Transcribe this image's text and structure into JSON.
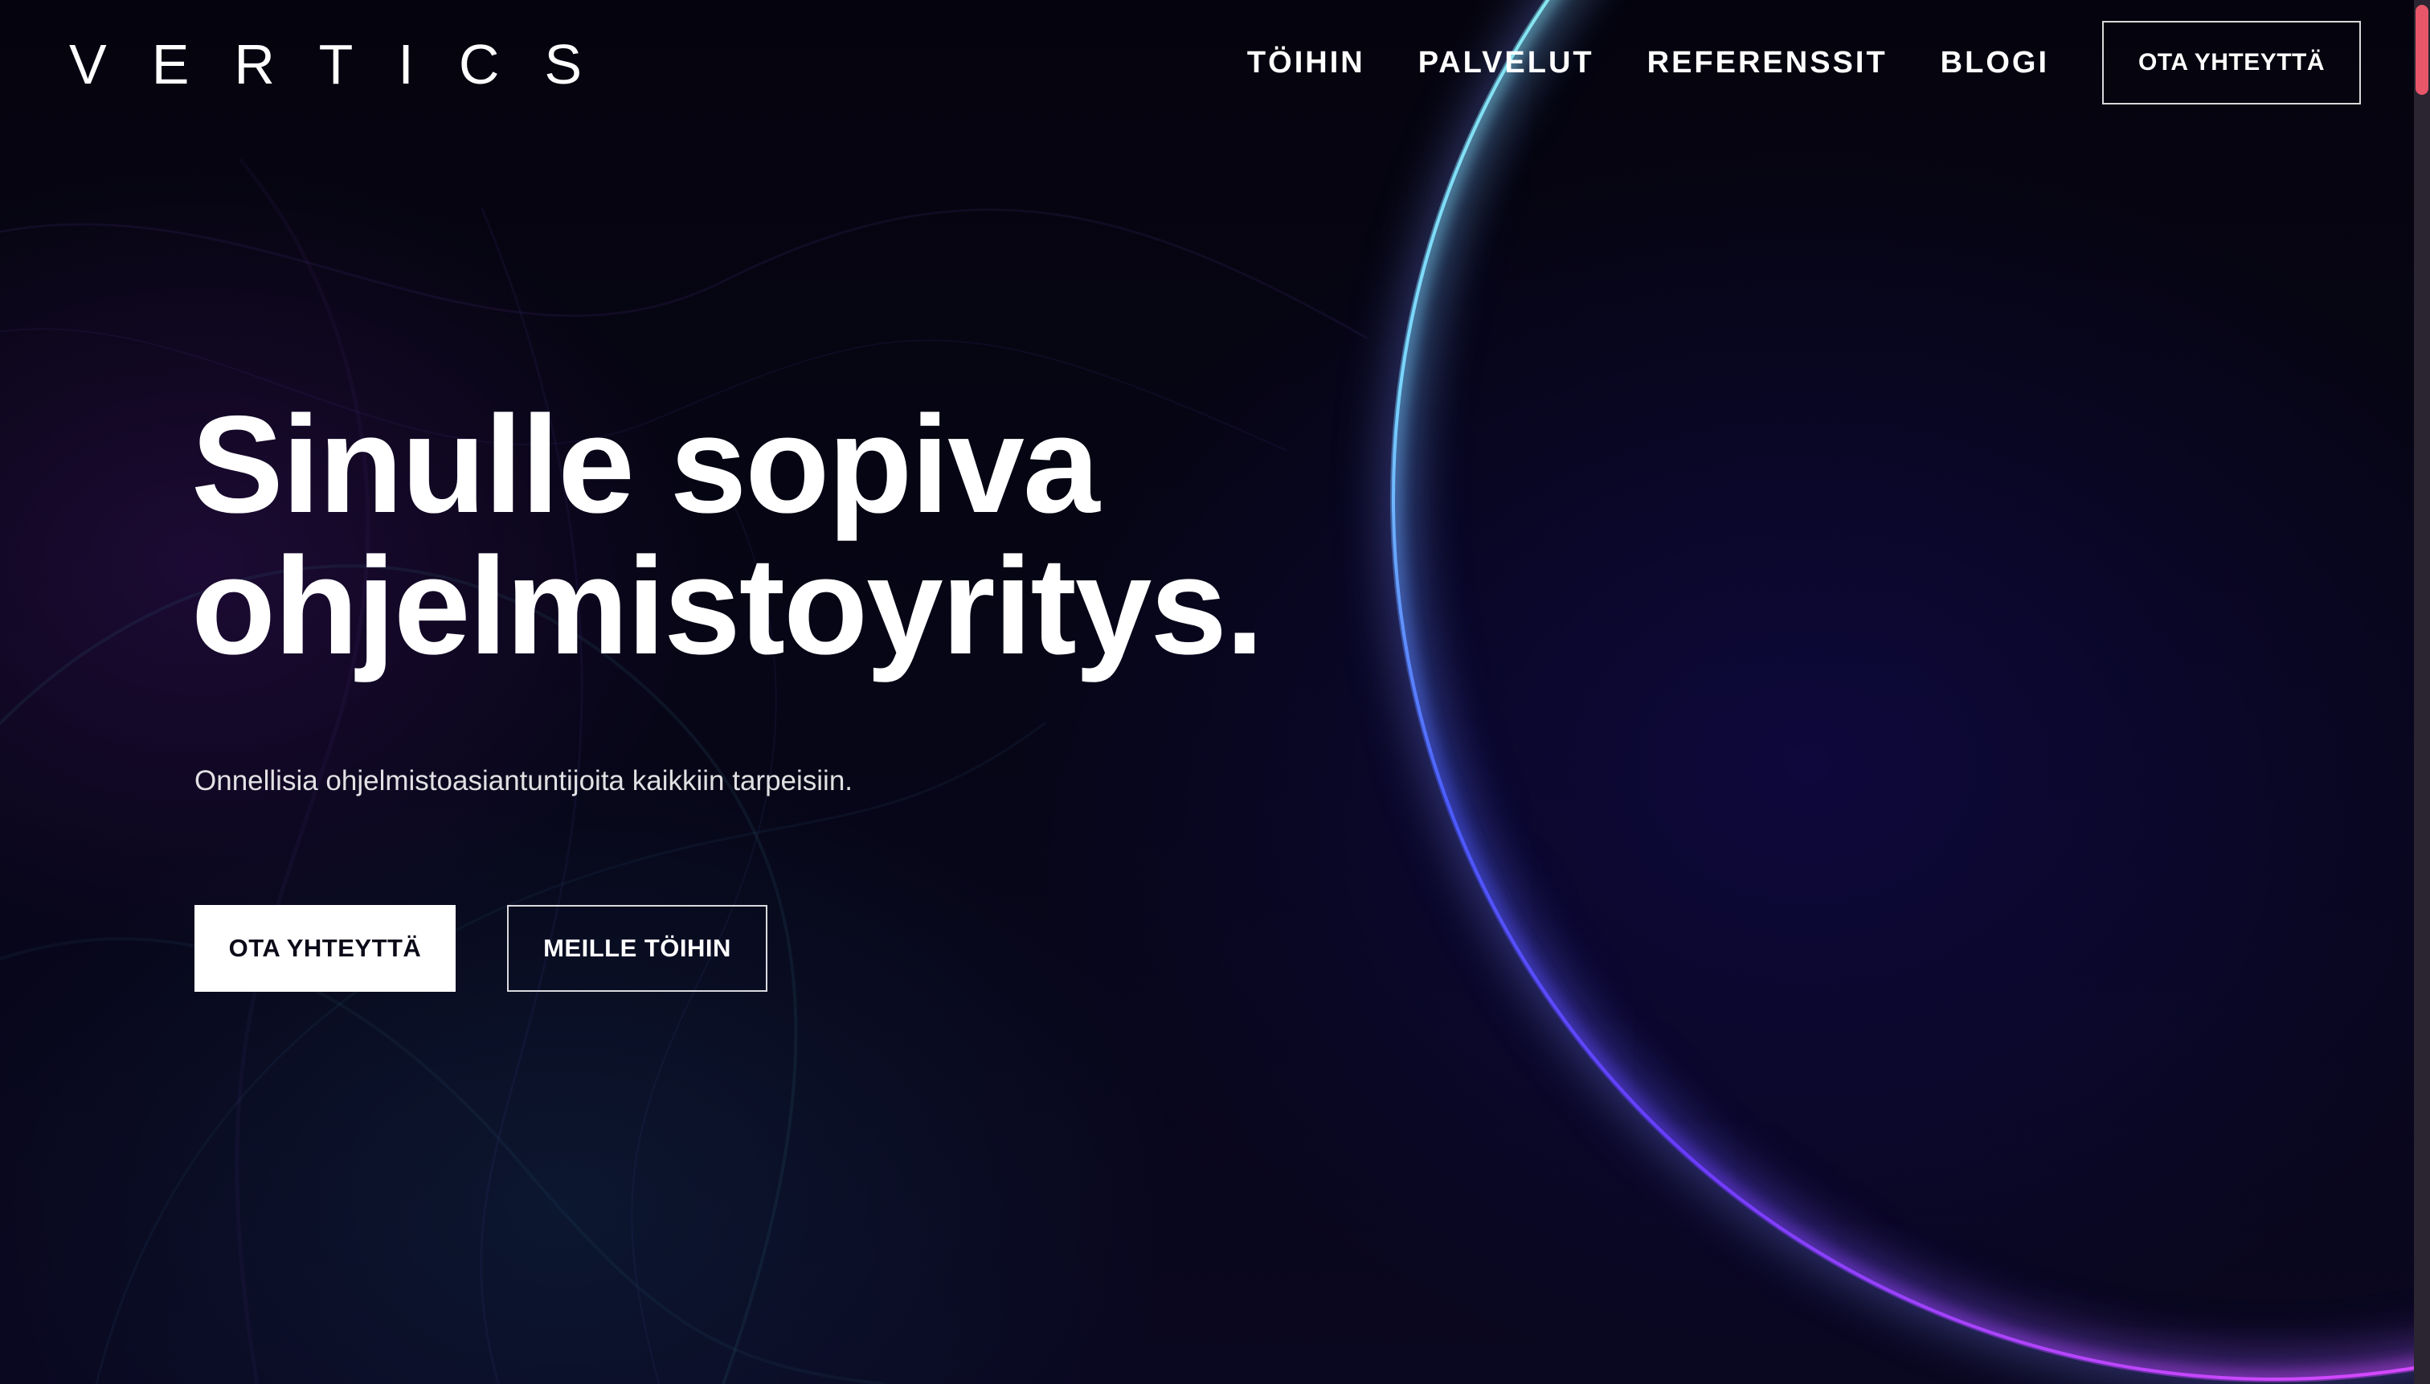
{
  "header": {
    "logo": "VERTICS",
    "nav": [
      {
        "label": "TÖIHIN"
      },
      {
        "label": "PALVELUT"
      },
      {
        "label": "REFERENSSIT"
      },
      {
        "label": "BLOGI"
      }
    ],
    "cta_label": "OTA YHTEYTTÄ"
  },
  "hero": {
    "title_line1": "Sinulle sopiva",
    "title_line2": "ohjelmistoyritys.",
    "subtitle": "Onnellisia ohjelmistoasiantuntijoita kaikkiin tarpeisiin.",
    "primary_button": "OTA YHTEYTTÄ",
    "secondary_button": "MEILLE TÖIHIN"
  },
  "colors": {
    "background": "#05040f",
    "ring_cyan": "#7fe6e8",
    "ring_blue": "#3b4cff",
    "ring_magenta": "#e040ff",
    "scroll_accent": "#e8566a"
  },
  "icons": {
    "background_art": "glowing-ring-icon"
  }
}
